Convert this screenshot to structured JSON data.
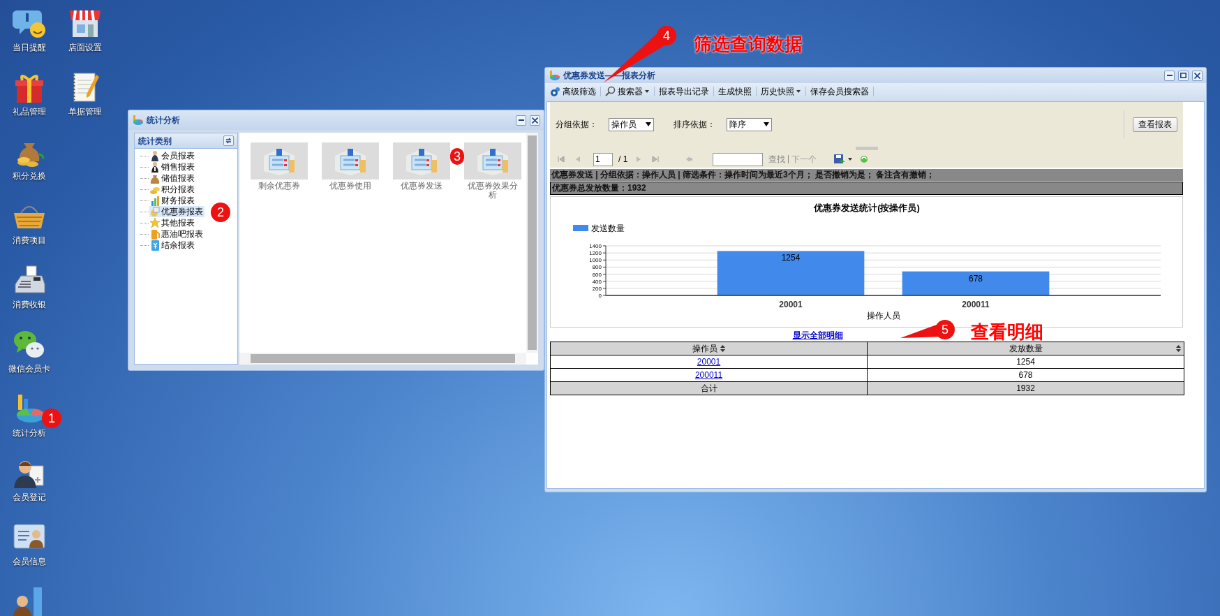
{
  "desktop_icons": [
    {
      "label": "当日提醒"
    },
    {
      "label": "店面设置"
    },
    {
      "label": "礼品管理"
    },
    {
      "label": "单据管理"
    },
    {
      "label": "积分兑换"
    },
    {
      "label": "消费项目"
    },
    {
      "label": "消费收银"
    },
    {
      "label": "微信会员卡"
    },
    {
      "label": "统计分析"
    },
    {
      "label": "会员登记"
    },
    {
      "label": "会员信息"
    }
  ],
  "stats_window": {
    "title": "统计分析",
    "tree": {
      "title": "统计类别",
      "items": [
        {
          "label": "会员报表",
          "selected": false
        },
        {
          "label": "销售报表",
          "selected": false
        },
        {
          "label": "储值报表",
          "selected": false
        },
        {
          "label": "积分报表",
          "selected": false
        },
        {
          "label": "财务报表",
          "selected": false
        },
        {
          "label": "优惠券报表",
          "selected": true
        },
        {
          "label": "其他报表",
          "selected": false
        },
        {
          "label": "惠油吧报表",
          "selected": false
        },
        {
          "label": "结余报表",
          "selected": false
        }
      ]
    },
    "tiles": [
      {
        "label": "剩余优惠券"
      },
      {
        "label": "优惠券使用"
      },
      {
        "label": "优惠券发送"
      },
      {
        "label": "优惠券效果分析"
      }
    ]
  },
  "report_window": {
    "title": "优惠券发送——报表分析",
    "toolbar": [
      {
        "label": "高级筛选",
        "dropdown": false
      },
      {
        "label": "搜索器",
        "dropdown": true
      },
      {
        "label": "报表导出记录",
        "dropdown": false
      },
      {
        "label": "生成快照",
        "dropdown": false
      },
      {
        "label": "历史快照",
        "dropdown": true
      },
      {
        "label": "保存会员搜索器",
        "dropdown": false
      }
    ],
    "filters": [
      {
        "label": "分组依据：",
        "value": "操作员"
      },
      {
        "label": "排序依据：",
        "value": "降序"
      }
    ],
    "view_button": "查看报表",
    "pager": {
      "page": "1",
      "total": "/ 1",
      "find_button": "查找",
      "next": {
        "label": "下一个",
        "disabled": true
      }
    },
    "summary": [
      "优惠券发送 | 分组依据：操作人员 | 筛选条件：操作时间为最近3个月； 是否撤销为是； 备注含有撤销；",
      "优惠券总发放数量：1932"
    ],
    "chart_data": {
      "type": "bar",
      "title": "优惠券发送统计(按操作员)",
      "xlabel": "操作人员",
      "categories": [
        "20001",
        "200011"
      ],
      "series": [
        {
          "name": "发送数量",
          "color": "#418aeb",
          "values": [
            1254,
            678
          ]
        }
      ],
      "ylim": [
        0,
        1400
      ],
      "grid": true,
      "yticks": [
        0,
        200,
        400,
        600,
        800,
        1000,
        1200,
        1400
      ],
      "data_labels": true
    },
    "detail_link": "显示全部明细",
    "table": {
      "columns": [
        "操作员",
        "发放数量"
      ],
      "rows": [
        {
          "kind": "data",
          "cells": [
            "20001",
            "1254"
          ]
        },
        {
          "kind": "data",
          "cells": [
            "200011",
            "678"
          ]
        },
        {
          "kind": "total",
          "cells": [
            "合计",
            "1932"
          ]
        }
      ]
    }
  },
  "annotations": [
    {
      "number": "1"
    },
    {
      "number": "2"
    },
    {
      "number": "3"
    },
    {
      "number": "4",
      "label": "筛选查询数据"
    },
    {
      "number": "5",
      "label": "查看明细"
    }
  ]
}
